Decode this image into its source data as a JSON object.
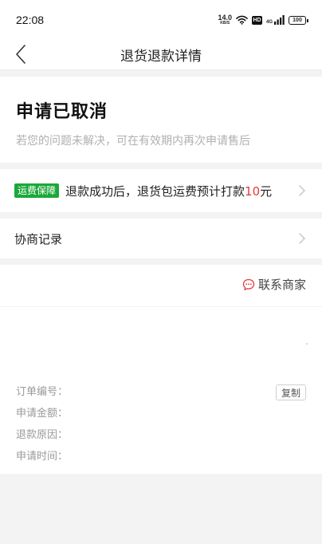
{
  "status_bar": {
    "time": "22:08",
    "net_speed_value": "14.0",
    "net_speed_unit": "KB/S",
    "hd_label": "HD",
    "signal_label": "4G",
    "battery_level": "100"
  },
  "nav": {
    "title": "退货退款详情",
    "back_icon": "chevron-left-icon"
  },
  "status_card": {
    "title": "申请已取消",
    "subtitle": "若您的问题未解决，可在有效期内再次申请售后"
  },
  "shipping": {
    "badge": "运费保障",
    "text": "退款成功后，退货包运费预计打款",
    "amount": "10",
    "unit": "元",
    "amount_color": "#e4393c",
    "badge_color": "#1aa83a"
  },
  "negotiation": {
    "label": "协商记录"
  },
  "details": {
    "contact_label": "联系商家",
    "contact_icon": "chat-bubble-icon",
    "copy_label": "复制",
    "fields": {
      "order_no": "订单编号：",
      "amount": "申请金额：",
      "reason": "退款原因：",
      "time": "申请时间："
    }
  }
}
